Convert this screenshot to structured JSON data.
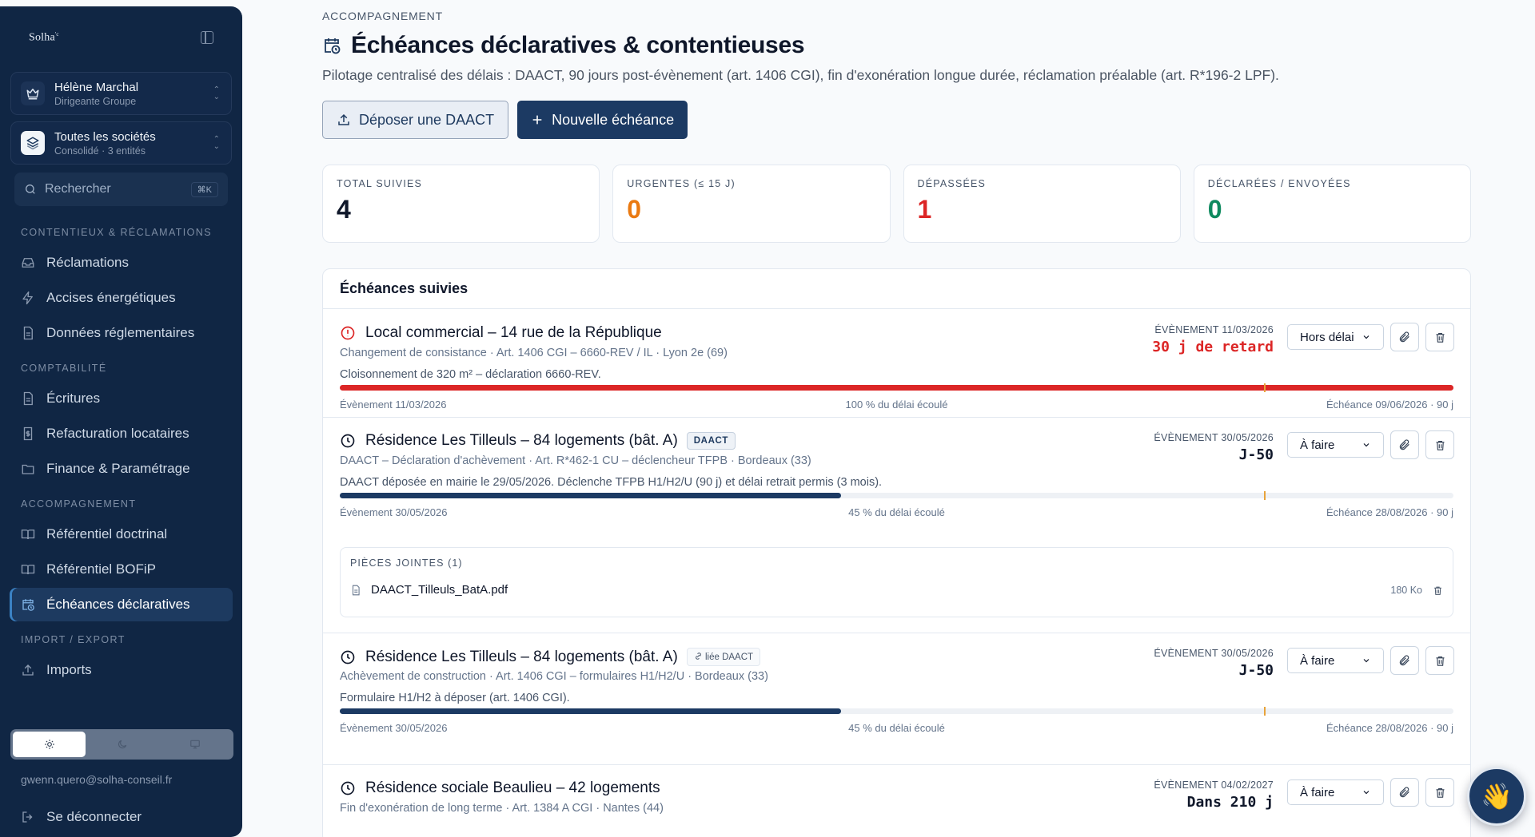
{
  "sidebar": {
    "brand": "Solha",
    "brand_sup": "'c",
    "user": {
      "name": "Hélène Marchal",
      "role": "Dirigeante Groupe"
    },
    "company": {
      "name": "Toutes les sociétés",
      "sub": "Consolidé · 3 entités"
    },
    "search": {
      "label": "Rechercher",
      "shortcut": "⌘K"
    },
    "sections": [
      {
        "title": "CONTENTIEUX & RÉCLAMATIONS",
        "items": [
          {
            "label": "Réclamations",
            "icon": "inbox-icon"
          },
          {
            "label": "Accises énergétiques",
            "icon": "bolt-icon"
          },
          {
            "label": "Données réglementaires",
            "icon": "document-icon"
          }
        ]
      },
      {
        "title": "COMPTABILITÉ",
        "items": [
          {
            "label": "Écritures",
            "icon": "document-icon"
          },
          {
            "label": "Refacturation locataires",
            "icon": "receipt-icon"
          },
          {
            "label": "Finance & Paramétrage",
            "icon": "folder-icon"
          }
        ]
      },
      {
        "title": "ACCOMPAGNEMENT",
        "items": [
          {
            "label": "Référentiel doctrinal",
            "icon": "book-icon"
          },
          {
            "label": "Référentiel BOFiP",
            "icon": "book-icon"
          },
          {
            "label": "Échéances déclaratives",
            "icon": "calendar-clock-icon",
            "active": true
          }
        ]
      },
      {
        "title": "IMPORT / EXPORT",
        "items": [
          {
            "label": "Imports",
            "icon": "upload-icon"
          }
        ]
      }
    ],
    "theme": {
      "options": [
        "light",
        "dark",
        "system"
      ],
      "selected": "light"
    },
    "email": "gwenn.quero@solha-conseil.fr",
    "logout": "Se déconnecter"
  },
  "page": {
    "breadcrumb": "ACCOMPAGNEMENT",
    "title": "Échéances déclaratives & contentieuses",
    "subtitle": "Pilotage centralisé des délais : DAACT, 90 jours post-évènement (art. 1406 CGI), fin d'exonération longue durée, réclamation préalable (art. R*196-2 LPF).",
    "actions": {
      "upload": "Déposer une DAACT",
      "create": "Nouvelle échéance"
    }
  },
  "stats": [
    {
      "label": "TOTAL SUIVIES",
      "value": "4",
      "color": "#0f172a"
    },
    {
      "label": "URGENTES (≤ 15 J)",
      "value": "0",
      "color": "#ea7a12"
    },
    {
      "label": "DÉPASSÉES",
      "value": "1",
      "color": "#dc2626"
    },
    {
      "label": "DÉCLARÉES / ENVOYÉES",
      "value": "0",
      "color": "#0f8a5f"
    }
  ],
  "panel": {
    "title": "Échéances suivies",
    "items": [
      {
        "name": "Local commercial – 14 rue de la République",
        "status_icon": "alert-circle-icon",
        "meta": "Changement de consistance · Art. 1406 CGI – 6660-REV / IL · Lyon 2e (69)",
        "desc": "Cloisonnement de 320 m² – déclaration 6660-REV.",
        "event": "ÉVÈNEMENT 11/03/2026",
        "delay": "30 j de retard",
        "delay_color": "#dc2626",
        "status": "Hors délai",
        "progress": 1.0,
        "progress_color": "#dc2626",
        "start": "Évènement 11/03/2026",
        "elapsed": "100 % du délai écoulé",
        "end": "Échéance 09/06/2026 · 90 j"
      },
      {
        "name": "Résidence Les Tilleuls – 84 logements (bât. A)",
        "status_icon": "clock-icon",
        "tag": "DAACT",
        "meta": "DAACT – Déclaration d'achèvement · Art. R*462-1 CU – déclencheur TFPB · Bordeaux (33)",
        "desc": "DAACT déposée en mairie le 29/05/2026. Déclenche TFPB H1/H2/U (90 j) et délai retrait permis (3 mois).",
        "event": "ÉVÈNEMENT 30/05/2026",
        "delay": "J-50",
        "delay_color": "#0f172a",
        "status": "À faire",
        "progress": 0.45,
        "progress_color": "#1c3a63",
        "start": "Évènement 30/05/2026",
        "elapsed": "45 % du délai écoulé",
        "end": "Échéance 28/08/2026 · 90 j",
        "attachments": {
          "title": "PIÈCES JOINTES (1)",
          "file": "DAACT_Tilleuls_BatA.pdf",
          "size": "180 Ko"
        }
      },
      {
        "name": "Résidence Les Tilleuls – 84 logements (bât. A)",
        "status_icon": "clock-icon",
        "link_tag": "liée DAACT",
        "meta": "Achèvement de construction · Art. 1406 CGI – formulaires H1/H2/U · Bordeaux (33)",
        "desc": "Formulaire H1/H2 à déposer (art. 1406 CGI).",
        "event": "ÉVÈNEMENT 30/05/2026",
        "delay": "J-50",
        "delay_color": "#0f172a",
        "status": "À faire",
        "progress": 0.45,
        "progress_color": "#1c3a63",
        "start": "Évènement 30/05/2026",
        "elapsed": "45 % du délai écoulé",
        "end": "Échéance 28/08/2026 · 90 j"
      },
      {
        "name": "Résidence sociale Beaulieu – 42 logements",
        "status_icon": "clock-icon",
        "meta": "Fin d'exonération de long terme · Art. 1384 A CGI · Nantes (44)",
        "event": "ÉVÈNEMENT 04/02/2027",
        "delay": "Dans 210 j",
        "delay_color": "#0f172a",
        "status": "À faire"
      }
    ]
  },
  "fab": {
    "icon": "👋"
  }
}
